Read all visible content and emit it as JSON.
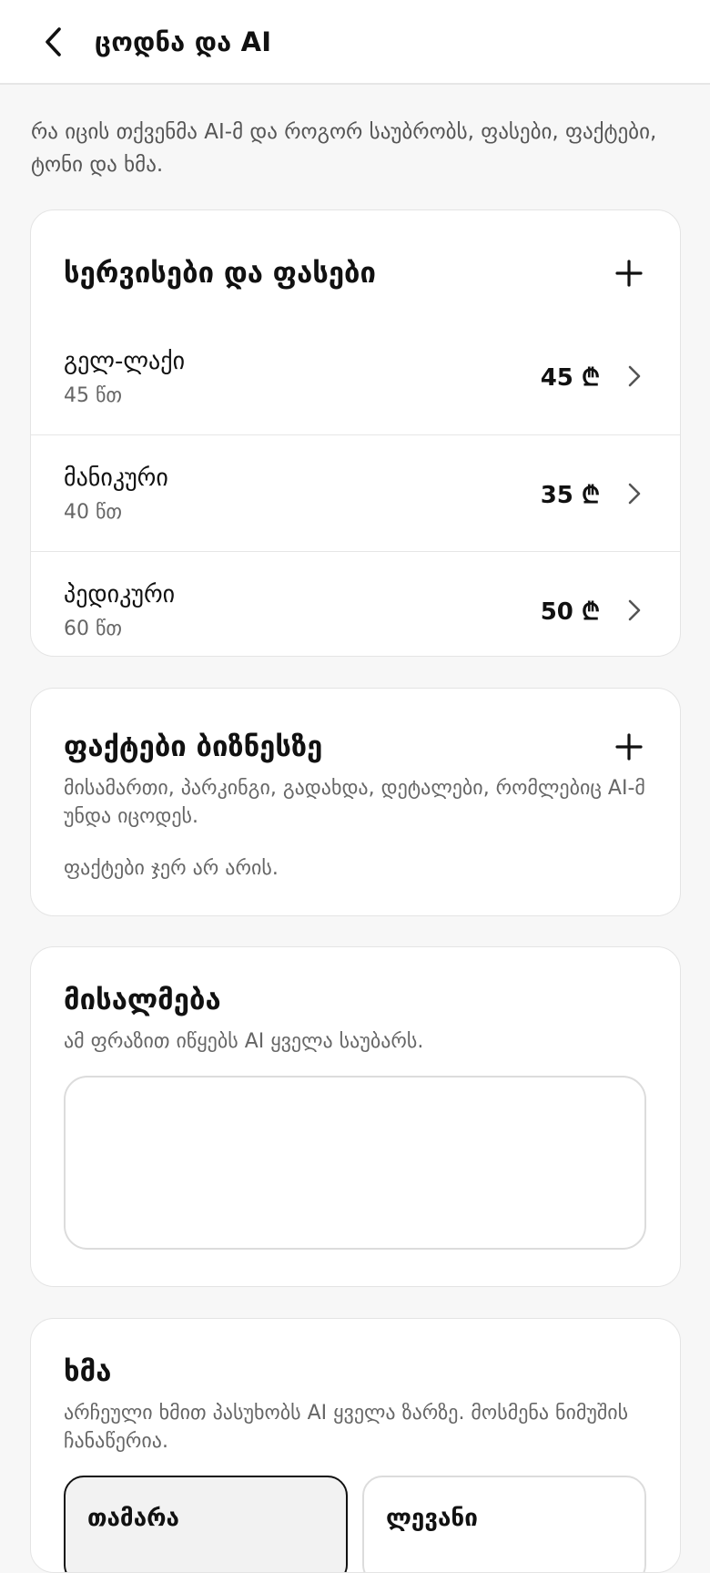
{
  "header": {
    "title": "ცოდნა და AI"
  },
  "intro": "რა იცის თქვენმა AI-მ და როგორ საუბრობს, ფასები, ფაქტები, ტონი და ხმა.",
  "services": {
    "title": "სერვისები და ფასები",
    "items": [
      {
        "name": "გელ-ლაქი",
        "duration": "45 წთ",
        "price": "45 ₾"
      },
      {
        "name": "მანიკური",
        "duration": "40 წთ",
        "price": "35 ₾"
      },
      {
        "name": "პედიკური",
        "duration": "60 წთ",
        "price": "50 ₾"
      }
    ]
  },
  "facts": {
    "title": "ფაქტები ბიზნესზე",
    "description": "მისამართი, პარკინგი, გადახდა, დეტალები, რომლებიც AI-მ უნდა იცოდეს.",
    "empty": "ფაქტები ჯერ არ არის."
  },
  "greeting": {
    "title": "მისალმება",
    "description": "ამ ფრაზით იწყებს AI ყველა საუბარს.",
    "value": ""
  },
  "voice": {
    "title": "ხმა",
    "description": "არჩეული ხმით პასუხობს AI ყველა ზარზე. მოსმენა ნიმუშის ჩანაწერია.",
    "options": [
      {
        "label": "თამარა",
        "selected": true
      },
      {
        "label": "ლევანი",
        "selected": false
      }
    ]
  }
}
